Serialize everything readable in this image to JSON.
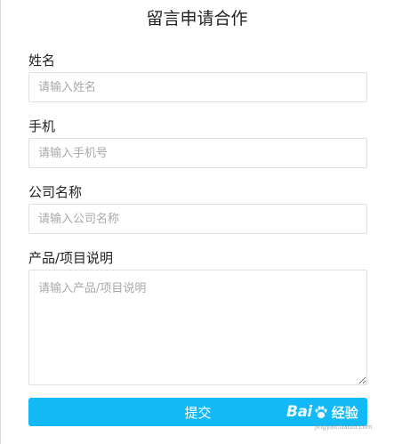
{
  "form": {
    "title": "留言申请合作",
    "fields": [
      {
        "label": "姓名",
        "placeholder": "请输入姓名",
        "value": ""
      },
      {
        "label": "手机",
        "placeholder": "请输入手机号",
        "value": ""
      },
      {
        "label": "公司名称",
        "placeholder": "请输入公司名称",
        "value": ""
      }
    ],
    "description": {
      "label": "产品/项目说明",
      "placeholder": "请输入产品/项目说明",
      "value": ""
    },
    "submit_label": "提交"
  },
  "watermark": {
    "brand_left": "Bai",
    "brand_right": "经验",
    "site": "jingyan.baidu.com"
  },
  "colors": {
    "submit_bg": "#12b9f7",
    "border": "#e0e0e0",
    "placeholder": "#a9a9a9"
  }
}
